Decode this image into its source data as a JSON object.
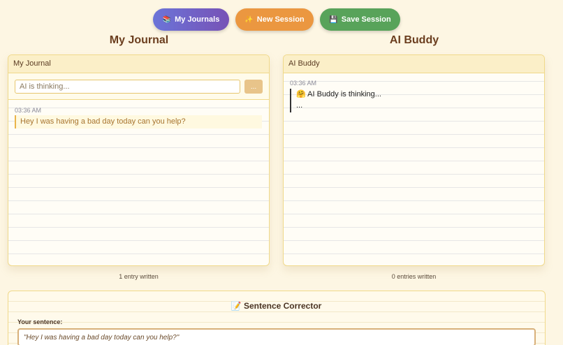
{
  "toolbar": {
    "journals_label": "My Journals",
    "journals_icon": "📚",
    "new_label": "New Session",
    "new_icon": "✨",
    "save_label": "Save Session",
    "save_icon": "💾"
  },
  "journal": {
    "heading": "My Journal",
    "panel_title": "My Journal",
    "input_value": "AI is thinking...",
    "send_label": "...",
    "entry_time": "03:36 AM",
    "entry_text": "Hey I was having a bad day today can you help?",
    "count_text": "1 entry written"
  },
  "buddy": {
    "heading": "AI Buddy",
    "panel_title": "AI Buddy",
    "entry_time": "03:36 AM",
    "thinking_icon": "🤗",
    "thinking_text": "AI Buddy is thinking...",
    "ellipsis": "...",
    "count_text": "0 entries written"
  },
  "corrector": {
    "icon": "📝",
    "title": "Sentence Corrector",
    "label": "Your sentence:",
    "value": "\"Hey I was having a bad day today can you help?\""
  }
}
